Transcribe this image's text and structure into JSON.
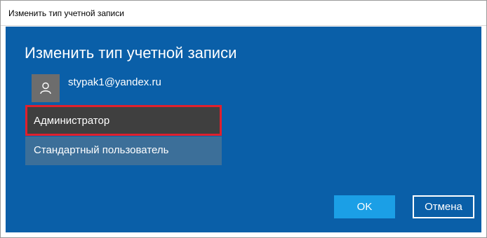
{
  "window": {
    "title": "Изменить тип учетной записи"
  },
  "dialog": {
    "heading": "Изменить тип учетной записи",
    "account": {
      "email": "stypak1@yandex.ru",
      "avatar_icon": "user-icon"
    },
    "account_type_options": [
      {
        "label": "Администратор",
        "selected": true
      },
      {
        "label": "Стандартный пользователь",
        "selected": false
      }
    ],
    "buttons": {
      "ok_label": "OK",
      "cancel_label": "Отмена"
    }
  },
  "colors": {
    "dialog_background": "#0a5fa8",
    "selected_option": "#3f3f3f",
    "unselected_option": "#3c6f99",
    "highlight_border": "#e0202d",
    "ok_button": "#1b9fe6"
  }
}
